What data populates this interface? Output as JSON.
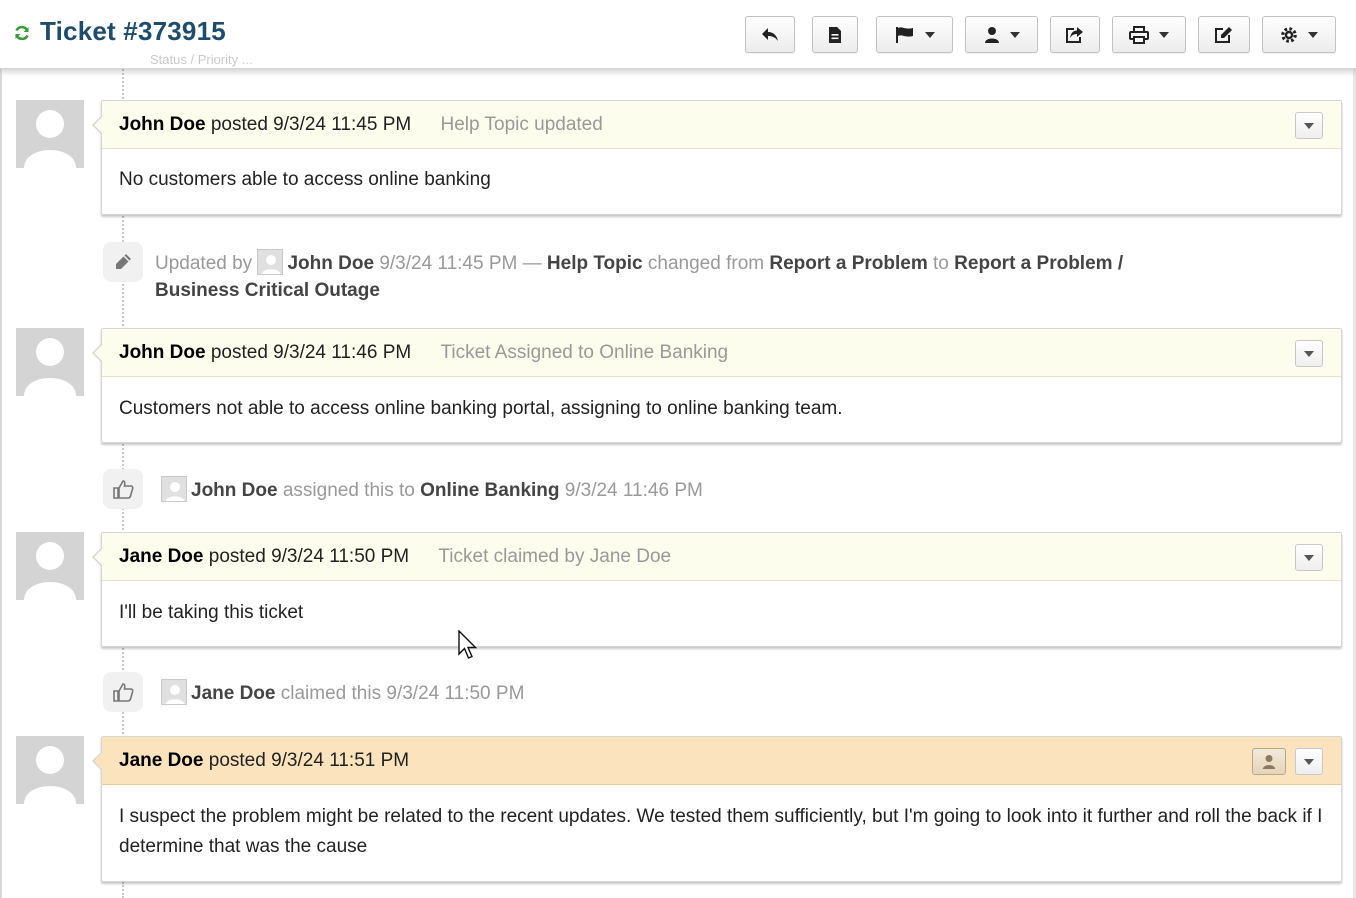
{
  "header": {
    "title": "Ticket #373915",
    "ghost_text": "Status / Priority ...",
    "buttons": [
      {
        "name": "reply",
        "icon": "reply-icon"
      },
      {
        "name": "post-note",
        "icon": "note-icon"
      },
      {
        "name": "flag",
        "icon": "flag-icon",
        "dropdown": true
      },
      {
        "name": "assign",
        "icon": "user-icon",
        "dropdown": true
      },
      {
        "name": "transfer",
        "icon": "share-icon"
      },
      {
        "name": "print",
        "icon": "print-icon",
        "dropdown": true
      },
      {
        "name": "edit",
        "icon": "edit-icon"
      },
      {
        "name": "settings",
        "icon": "gear-icon",
        "dropdown": true
      }
    ]
  },
  "threads": [
    {
      "author": "John Doe",
      "posted": "posted 9/3/24 11:45 PM",
      "note": "Help Topic updated",
      "body": "No customers able to access online banking",
      "highlight": false
    },
    {
      "author": "John Doe",
      "posted": "posted 9/3/24 11:46 PM",
      "note": "Ticket Assigned to Online Banking",
      "body": "Customers not able to access online banking portal, assigning to online banking team.",
      "highlight": false
    },
    {
      "author": "Jane Doe",
      "posted": "posted 9/3/24 11:50 PM",
      "note": "Ticket claimed by Jane Doe",
      "body": "I'll be taking this ticket",
      "highlight": false
    },
    {
      "author": "Jane Doe",
      "posted": "posted 9/3/24 11:51 PM",
      "note": "",
      "body": "I suspect the problem might be related to the recent updates. We tested them sufficiently, but I'm going to look into it further and roll the back if I determine that was the cause",
      "highlight": true
    }
  ],
  "events": [
    {
      "type": "edit",
      "prefix": "Updated by",
      "user": "John Doe",
      "time": "9/3/24 11:45 PM —",
      "field": "Help Topic",
      "changed_from": "changed from",
      "old_value": "Report a Problem",
      "to": "to",
      "new_value_line1": "Report a Problem /",
      "new_value_line2": "Business Critical Outage"
    },
    {
      "type": "assigned",
      "user": "John Doe",
      "action": "assigned this to",
      "target": "Online Banking",
      "time": "9/3/24 11:46 PM"
    },
    {
      "type": "claimed",
      "user": "Jane Doe",
      "action": "claimed this",
      "time": "9/3/24 11:50 PM"
    }
  ],
  "colors": {
    "title": "#1d4d6b",
    "thread_header": "#fdfdee",
    "thread_header_highlight": "#fbe3bd",
    "refresh_icon": "#3a9b3a"
  }
}
